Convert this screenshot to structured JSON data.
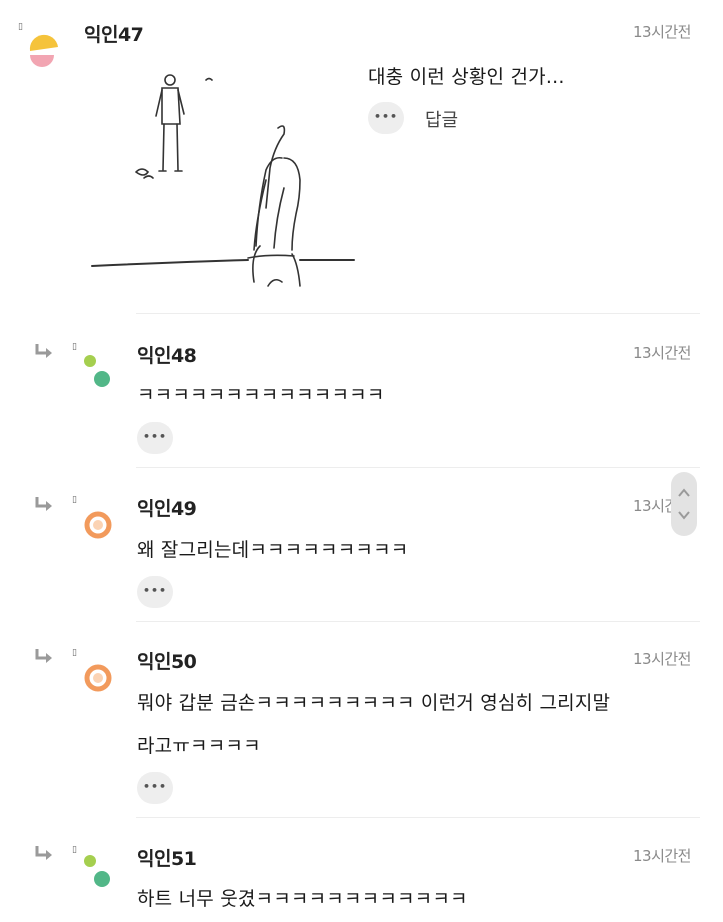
{
  "comments": [
    {
      "mark": "▯",
      "author": "익인47",
      "time": "13시간전",
      "text": "대충 이런 상황인 건가...",
      "reply_label": "답글"
    },
    {
      "mark": "▯",
      "author": "익인48",
      "time": "13시간전",
      "text": "ㅋㅋㅋㅋㅋㅋㅋㅋㅋㅋㅋㅋㅋㅋ"
    },
    {
      "mark": "▯",
      "author": "익인49",
      "time": "13시간전",
      "text": "왜 잘그리는데ㅋㅋㅋㅋㅋㅋㅋㅋㅋ"
    },
    {
      "mark": "▯",
      "author": "익인50",
      "time": "13시간전",
      "text_line1": "뭐야 갑분 금손ㅋㅋㅋㅋㅋㅋㅋㅋㅋ 이런거 영심히 그리지말",
      "text_line2": "라고ㅠㅋㅋㅋㅋ"
    },
    {
      "mark": "▯",
      "author": "익인51",
      "time": "13시간전",
      "text": "하트 너무 웃겼ㅋㅋㅋㅋㅋㅋㅋㅋㅋㅋㅋㅋ"
    }
  ],
  "more_label": "•••",
  "colors": {
    "avatar_yellow": "#f5c33b",
    "avatar_pink": "#f2a5b2",
    "avatar_green": "#52b788",
    "avatar_lime": "#a5cf4f",
    "avatar_orange": "#f29a5c"
  }
}
